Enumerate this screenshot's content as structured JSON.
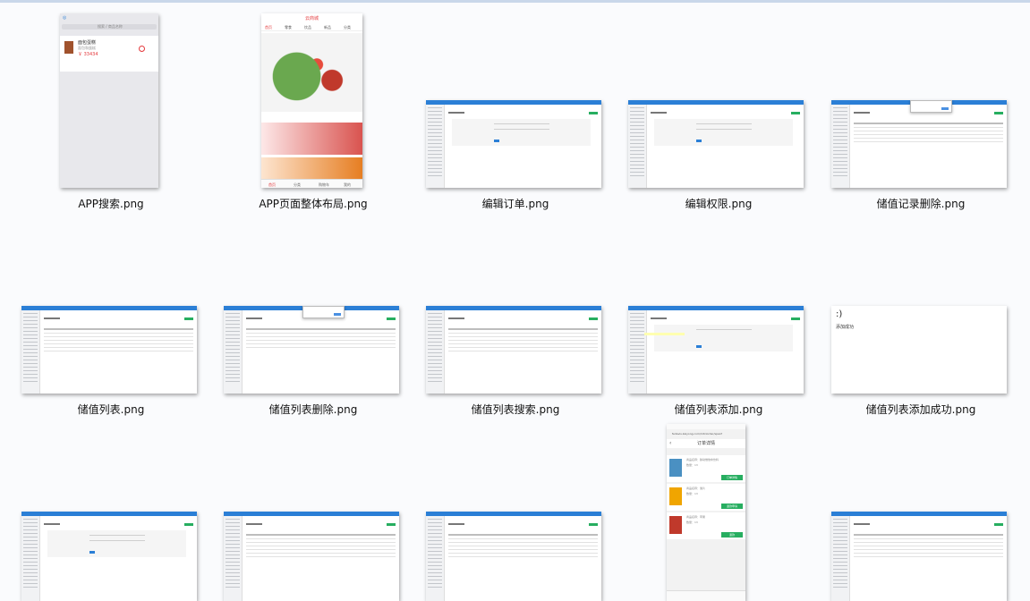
{
  "files": [
    {
      "name": "APP搜索.png",
      "kind": "phone-search",
      "search_placeholder": "搜索 / 商品名称",
      "product_name": "面包蛋糕",
      "product_desc": "面包和蛋糕",
      "product_price": "￥ 33434"
    },
    {
      "name": "APP页面整体布局.png",
      "kind": "phone-home",
      "title": "云商城",
      "tabs": [
        "首页",
        "零食",
        "饮品",
        "新品",
        "分类"
      ],
      "bottom_nav": [
        "首页",
        "分类",
        "购物车",
        "我的"
      ]
    },
    {
      "name": "编辑订单.png",
      "kind": "admin-form"
    },
    {
      "name": "编辑权限.png",
      "kind": "admin-form"
    },
    {
      "name": "储值记录删除.png",
      "kind": "admin-dialog"
    },
    {
      "name": "储值列表.png",
      "kind": "admin-table"
    },
    {
      "name": "储值列表删除.png",
      "kind": "admin-dialog"
    },
    {
      "name": "储值列表搜索.png",
      "kind": "admin-table"
    },
    {
      "name": "储值列表添加.png",
      "kind": "admin-add"
    },
    {
      "name": "储值列表添加成功.png",
      "kind": "success",
      "smiley": ":)",
      "message": "添加成功"
    },
    {
      "name": "",
      "kind": "admin-form"
    },
    {
      "name": "",
      "kind": "admin-table"
    },
    {
      "name": "",
      "kind": "admin-table"
    },
    {
      "name": "",
      "kind": "phone-order",
      "url": "fedavis.kaiyong.com/mtclorder/spaof",
      "header": "订单详情",
      "items": [
        {
          "label": "商品名称：脉动维他命饮料",
          "qty": "数量：13",
          "button": "订单详情"
        },
        {
          "label": "商品名称：薯片",
          "qty": "数量：13",
          "button": "退款申请"
        },
        {
          "label": "商品名称：苹果",
          "qty": "数量：13",
          "button": "退款"
        }
      ]
    },
    {
      "name": "",
      "kind": "admin-table"
    }
  ]
}
